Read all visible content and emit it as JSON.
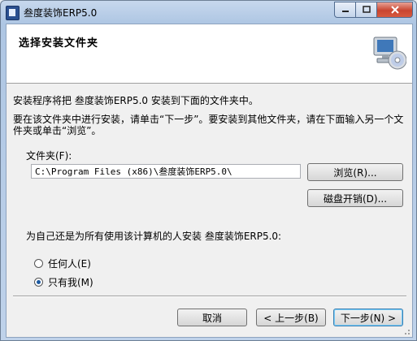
{
  "window": {
    "title": "叁度装饰ERP5.0",
    "minimize_icon": "minimize-icon",
    "maximize_icon": "maximize-icon",
    "close_icon": "close-icon"
  },
  "header": {
    "title": "选择安装文件夹",
    "art_icon": "computer-cd-icon"
  },
  "body": {
    "intro_line": "安装程序将把 叁度装饰ERP5.0 安装到下面的文件夹中。",
    "instructions": "要在该文件夹中进行安装，请单击“下一步”。要安装到其他文件夹，请在下面输入另一个文件夹或单击“浏览”。",
    "folder_label": "文件夹(F):",
    "folder_value": "C:\\Program Files (x86)\\叁度装饰ERP5.0\\",
    "browse_label": "浏览(R)...",
    "disk_cost_label": "磁盘开销(D)...",
    "install_for_prompt": "为自己还是为所有使用该计算机的人安装 叁度装饰ERP5.0:",
    "radio_everyone": "任何人(E)",
    "radio_just_me": "只有我(M)",
    "selected_option": "just_me"
  },
  "footer": {
    "cancel_label": "取消",
    "back_label": "< 上一步(B)",
    "next_label": "下一步(N) >"
  }
}
